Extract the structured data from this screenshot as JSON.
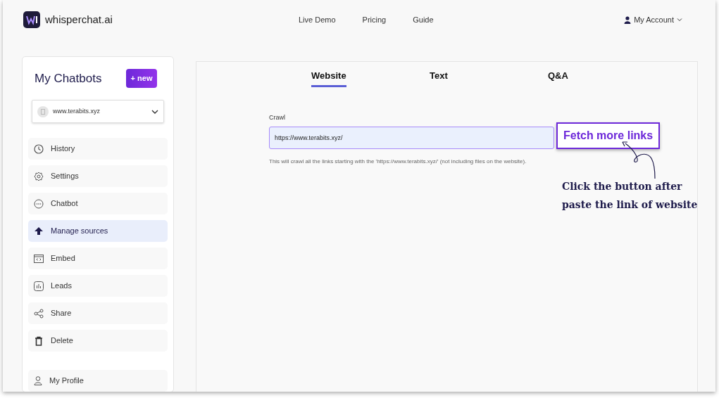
{
  "header": {
    "brand": "whisperchat.ai",
    "nav": [
      "Live Demo",
      "Pricing",
      "Guide"
    ],
    "account": "My Account"
  },
  "sidebar": {
    "title": "My Chatbots",
    "new_button": "+ new",
    "bot_select": "www.terabits.xyz",
    "items": [
      {
        "kind": "history",
        "label": "History",
        "selected": false
      },
      {
        "kind": "settings",
        "label": "Settings",
        "selected": false
      },
      {
        "kind": "chatbot",
        "label": "Chatbot",
        "selected": false
      },
      {
        "kind": "sources",
        "label": "Manage sources",
        "selected": true
      },
      {
        "kind": "embed",
        "label": "Embed",
        "selected": false
      },
      {
        "kind": "leads",
        "label": "Leads",
        "selected": false
      },
      {
        "kind": "share",
        "label": "Share",
        "selected": false
      },
      {
        "kind": "delete",
        "label": "Delete",
        "selected": false
      }
    ],
    "profile": "My Profile"
  },
  "tabs": [
    {
      "label": "Website",
      "selected": true
    },
    {
      "label": "Text",
      "selected": false
    },
    {
      "label": "Q&A",
      "selected": false
    }
  ],
  "crawl": {
    "label": "Crawl",
    "value": "https://www.terabits.xyz/",
    "button": "Fetch more links",
    "help": "This will crawl all the links starting with the 'https://www.terabits.xyz/' (not including files on the website)."
  },
  "annotation": [
    "Click the button after",
    "paste the link of website"
  ]
}
